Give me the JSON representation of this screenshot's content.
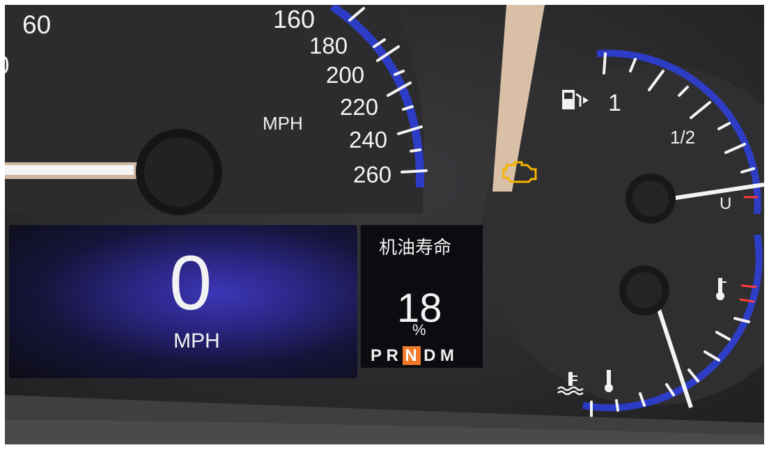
{
  "speedometer": {
    "labels": [
      "60",
      "160",
      "180",
      "200",
      "220",
      "240",
      "260"
    ],
    "unit_label": "MPH",
    "partial_glyph": "0"
  },
  "display": {
    "speed_value": "0",
    "speed_unit": "MPH",
    "info_title": "机油寿命",
    "oil_life_value": "18",
    "oil_life_unit": "%",
    "gears": [
      "P",
      "R",
      "N",
      "D",
      "M"
    ],
    "selected_gear": "N"
  },
  "fuel_gauge": {
    "label_full": "1",
    "label_half": "1/2",
    "label_empty": "U"
  },
  "colors": {
    "accent_blue": "#3a4bff",
    "warning_amber": "#f5b400",
    "gear_highlight": "#f07a2a",
    "redline": "#ff3a3a"
  },
  "icons": [
    "fuel-pump-icon",
    "check-engine-icon",
    "temperature-icon",
    "coolant-temperature-icon"
  ]
}
